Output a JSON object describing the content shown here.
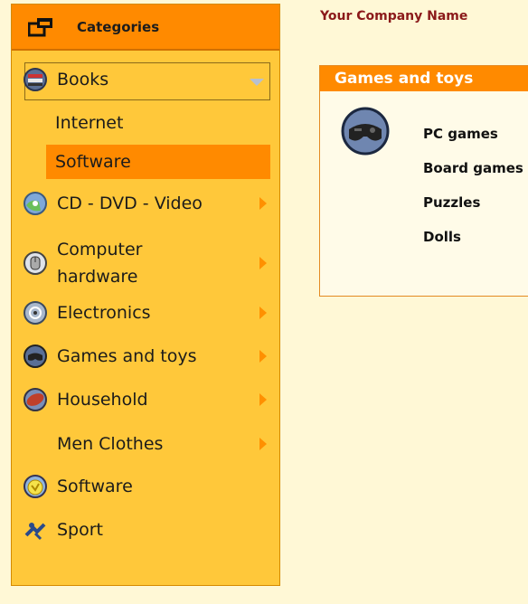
{
  "sidebar": {
    "title": "Categories",
    "items": [
      {
        "label": "Books",
        "icon": "books-icon",
        "expanded": true
      },
      {
        "label": "CD - DVD - Video",
        "icon": "cd-dvd-icon"
      },
      {
        "label": "Computer hardware",
        "icon": "computer-hardware-icon"
      },
      {
        "label": "Electronics",
        "icon": "electronics-icon"
      },
      {
        "label": "Games and toys",
        "icon": "gamepad-icon"
      },
      {
        "label": "Household",
        "icon": "household-icon"
      },
      {
        "label": "Men Clothes",
        "icon": ""
      },
      {
        "label": "Software",
        "icon": "software-icon"
      },
      {
        "label": "Sport",
        "icon": "sport-icon"
      }
    ],
    "subitems": [
      {
        "label": "Internet",
        "active": false
      },
      {
        "label": "Software",
        "active": true
      }
    ]
  },
  "header": {
    "company": "Your Company Name"
  },
  "main": {
    "panel_title": "Games and toys",
    "links": [
      "PC games",
      "Board games",
      "Puzzles",
      "Dolls"
    ]
  },
  "colors": {
    "orange": "#FF8A00",
    "sidebar": "#FFC83A",
    "background": "#FFF8D6",
    "company": "#8B1A1A"
  }
}
